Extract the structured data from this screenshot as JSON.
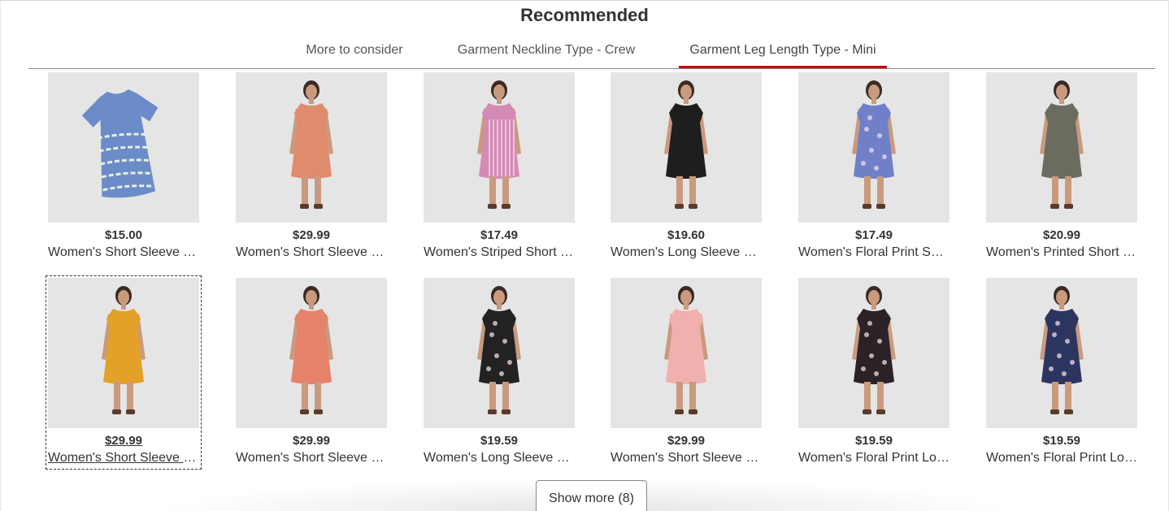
{
  "section": {
    "title": "Recommended"
  },
  "tabs": [
    {
      "label": "More to consider",
      "active": false
    },
    {
      "label": "Garment Neckline Type - Crew",
      "active": false
    },
    {
      "label": "Garment Leg Length Type - Mini",
      "active": true
    }
  ],
  "colors": {
    "accent": "#cc0000",
    "image_bg": "#e5e5e5"
  },
  "products": [
    {
      "price": "$15.00",
      "name": "Women's Short Sleeve T-Shirt Dress",
      "dress_color": "#6b8cc9",
      "pattern": "tie-dye",
      "type": "flat"
    },
    {
      "price": "$29.99",
      "name": "Women's Short Sleeve Dress",
      "dress_color": "#e08a6e",
      "pattern": "solid",
      "type": "model"
    },
    {
      "price": "$17.49",
      "name": "Women's Striped Short Sleeve Dress",
      "dress_color": "#d58ab5",
      "pattern": "stripes",
      "type": "model"
    },
    {
      "price": "$19.60",
      "name": "Women's Long Sleeve Dress",
      "dress_color": "#1e1e1e",
      "pattern": "solid",
      "type": "model"
    },
    {
      "price": "$17.49",
      "name": "Women's Floral Print Short Sleeve Dress",
      "dress_color": "#6f80c8",
      "pattern": "floral",
      "type": "model"
    },
    {
      "price": "$20.99",
      "name": "Women's Printed Short Sleeve Dress",
      "dress_color": "#6b6b60",
      "pattern": "solid",
      "type": "model"
    },
    {
      "price": "$29.99",
      "name": "Women's Short Sleeve Dress",
      "dress_color": "#e3a12a",
      "pattern": "solid",
      "type": "model",
      "focused": true
    },
    {
      "price": "$29.99",
      "name": "Women's Short Sleeve Dress",
      "dress_color": "#e4826a",
      "pattern": "solid",
      "type": "model"
    },
    {
      "price": "$19.59",
      "name": "Women's Long Sleeve Dress",
      "dress_color": "#222222",
      "pattern": "floral",
      "type": "model"
    },
    {
      "price": "$29.99",
      "name": "Women's Short Sleeve Dress",
      "dress_color": "#f0b0ae",
      "pattern": "solid",
      "type": "model"
    },
    {
      "price": "$19.59",
      "name": "Women's Floral Print Long Sleeve Dress",
      "dress_color": "#2a2226",
      "pattern": "floral",
      "type": "model"
    },
    {
      "price": "$19.59",
      "name": "Women's Floral Print Long Sleeve Dress",
      "dress_color": "#2c3560",
      "pattern": "floral",
      "type": "model"
    }
  ],
  "show_more": {
    "label": "Show more (8)"
  }
}
